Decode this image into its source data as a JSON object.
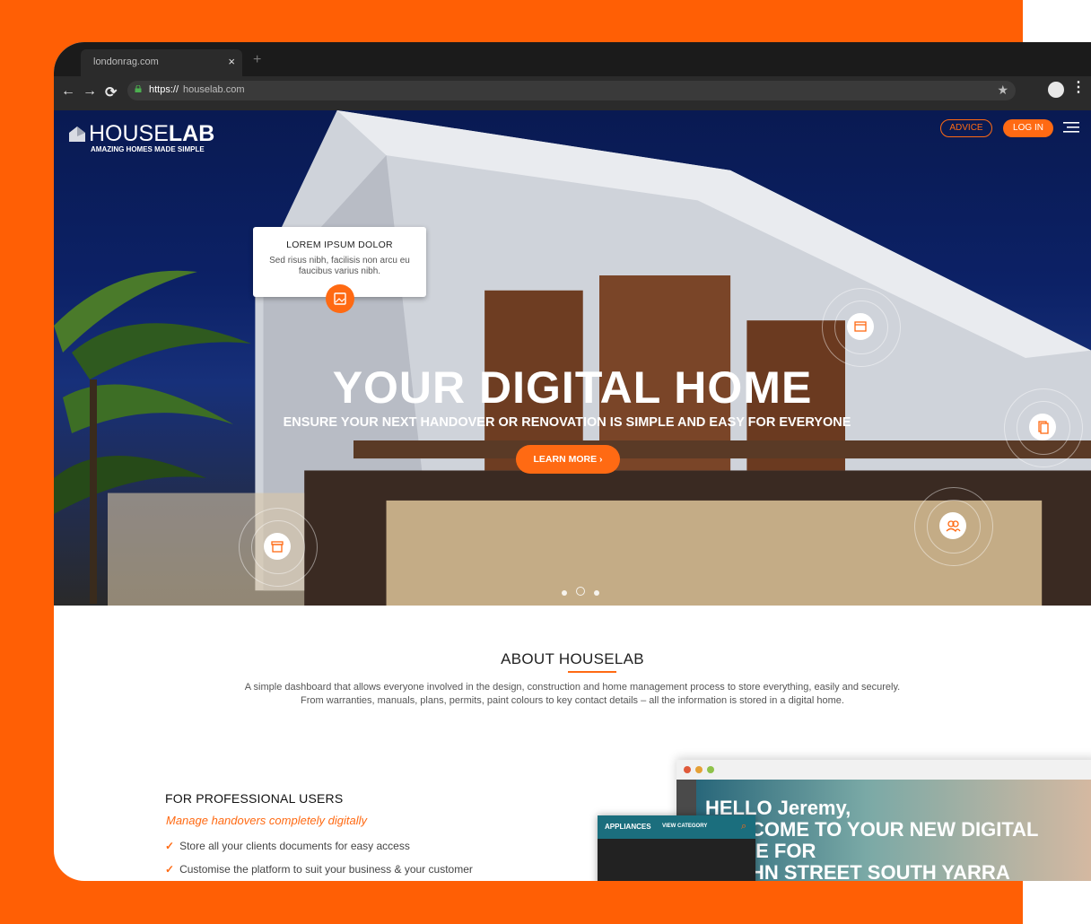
{
  "browser": {
    "tab_title": "londonrag.com",
    "tab_close": "×",
    "new_tab": "+",
    "url_scheme": "https://",
    "url_host": "houselab.com",
    "nav_back": "←",
    "nav_forward": "→",
    "nav_reload": "⟳",
    "bookmark": "★",
    "menu": "⋮"
  },
  "site": {
    "logo_light": "HOUSE",
    "logo_bold": "LAB",
    "tagline": "AMAZING HOMES MADE SIMPLE",
    "advice_label": "ADVICE",
    "login_label": "LOG IN"
  },
  "card": {
    "title": "LOREM IPSUM DOLOR",
    "body": "Sed risus nibh, facilisis non arcu eu faucibus varius nibh."
  },
  "hero": {
    "title": "YOUR DIGITAL HOME",
    "subtitle": "ENSURE YOUR NEXT HANDOVER OR RENOVATION IS SIMPLE AND EASY FOR EVERYONE",
    "cta_label": "LEARN MORE",
    "cta_arrow": "›",
    "slides_total": 3,
    "active_slide": 2
  },
  "about": {
    "title": "ABOUT HOUSELAB",
    "line1": "A simple dashboard that allows everyone involved in the design, construction and home management process to store everything, easily and securely.",
    "line2": "From warranties, manuals, plans, permits, paint colours to key contact details – all the information is stored in a digital home."
  },
  "professional": {
    "title": "FOR PROFESSIONAL USERS",
    "subtitle": "Manage handovers completely digitally",
    "items": [
      "Store all your clients documents for easy access",
      "Customise the platform to suit your business & your customer"
    ]
  },
  "mockup": {
    "line1": "HELLO Jeremy,",
    "line2": "COME TO YOUR NEW DIGITAL",
    "line3": "IE FOR",
    "line4": "HN STREET SOUTH YARRA",
    "appliances": "APPLIANCES",
    "view_category": "VIEW CATEGORY"
  },
  "colors": {
    "accent": "#ff6a13",
    "background": "#ff5f05"
  }
}
